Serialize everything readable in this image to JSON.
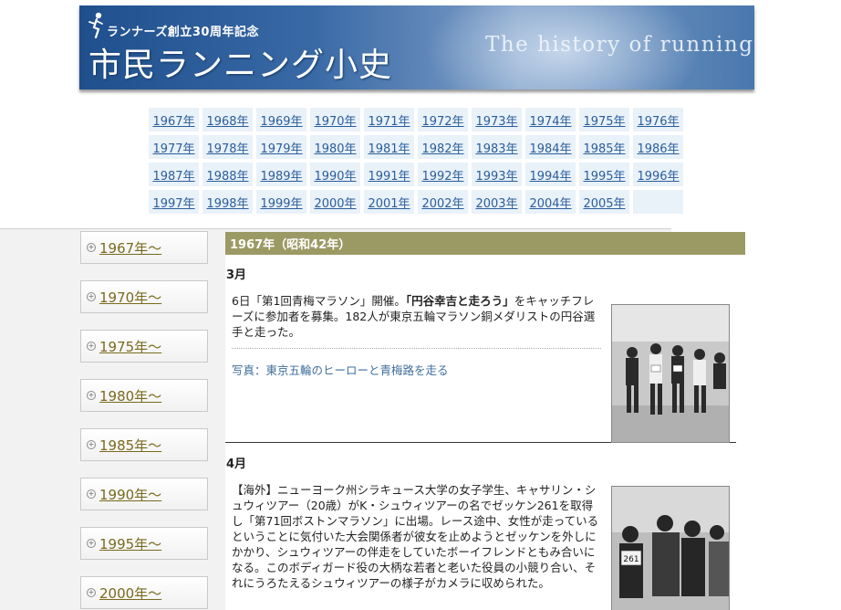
{
  "header": {
    "subtitle": "ランナーズ創立30周年記念",
    "title": "市民ランニング小史",
    "english_title": "The history of running"
  },
  "year_links": [
    "1967年",
    "1968年",
    "1969年",
    "1970年",
    "1971年",
    "1972年",
    "1973年",
    "1974年",
    "1975年",
    "1976年",
    "1977年",
    "1978年",
    "1979年",
    "1980年",
    "1981年",
    "1982年",
    "1983年",
    "1984年",
    "1985年",
    "1986年",
    "1987年",
    "1988年",
    "1989年",
    "1990年",
    "1991年",
    "1992年",
    "1993年",
    "1994年",
    "1995年",
    "1996年",
    "1997年",
    "1998年",
    "1999年",
    "2000年",
    "2001年",
    "2002年",
    "2003年",
    "2004年",
    "2005年"
  ],
  "sidebar": {
    "items": [
      {
        "label": "1967年〜"
      },
      {
        "label": "1970年〜"
      },
      {
        "label": "1975年〜"
      },
      {
        "label": "1980年〜"
      },
      {
        "label": "1985年〜"
      },
      {
        "label": "1990年〜"
      },
      {
        "label": "1995年〜"
      },
      {
        "label": "2000年〜"
      }
    ]
  },
  "content": {
    "year_header": "1967年（昭和42年）",
    "sections": [
      {
        "month": "3月",
        "text_before": "6日「第1回青梅マラソン」開催。",
        "text_bold": "「円谷幸吉と走ろう」",
        "text_after": "をキャッチフレーズに参加者を募集。182人が東京五輪マラソン銅メダリストの円谷選手と走った。",
        "caption": "写真：東京五輪のヒーローと青梅路を走る"
      },
      {
        "month": "4月",
        "text": "【海外】ニューヨーク州シラキュース大学の女子学生、キャサリン・シュウィツアー（20歳）がK・シュウィツアーの名でゼッケン261を取得し「第71回ボストンマラソン」に出場。レース途中、女性が走っているということに気付いた大会関係者が彼女を止めようとゼッケンを外しにかかり、シュウィツアーの伴走をしていたボーイフレンドともみ合いになる。このボディガード役の大柄な若者と老いた役員の小競り合い、それにうろたえるシュウィツアーの様子がカメラに収められた。"
      }
    ]
  }
}
